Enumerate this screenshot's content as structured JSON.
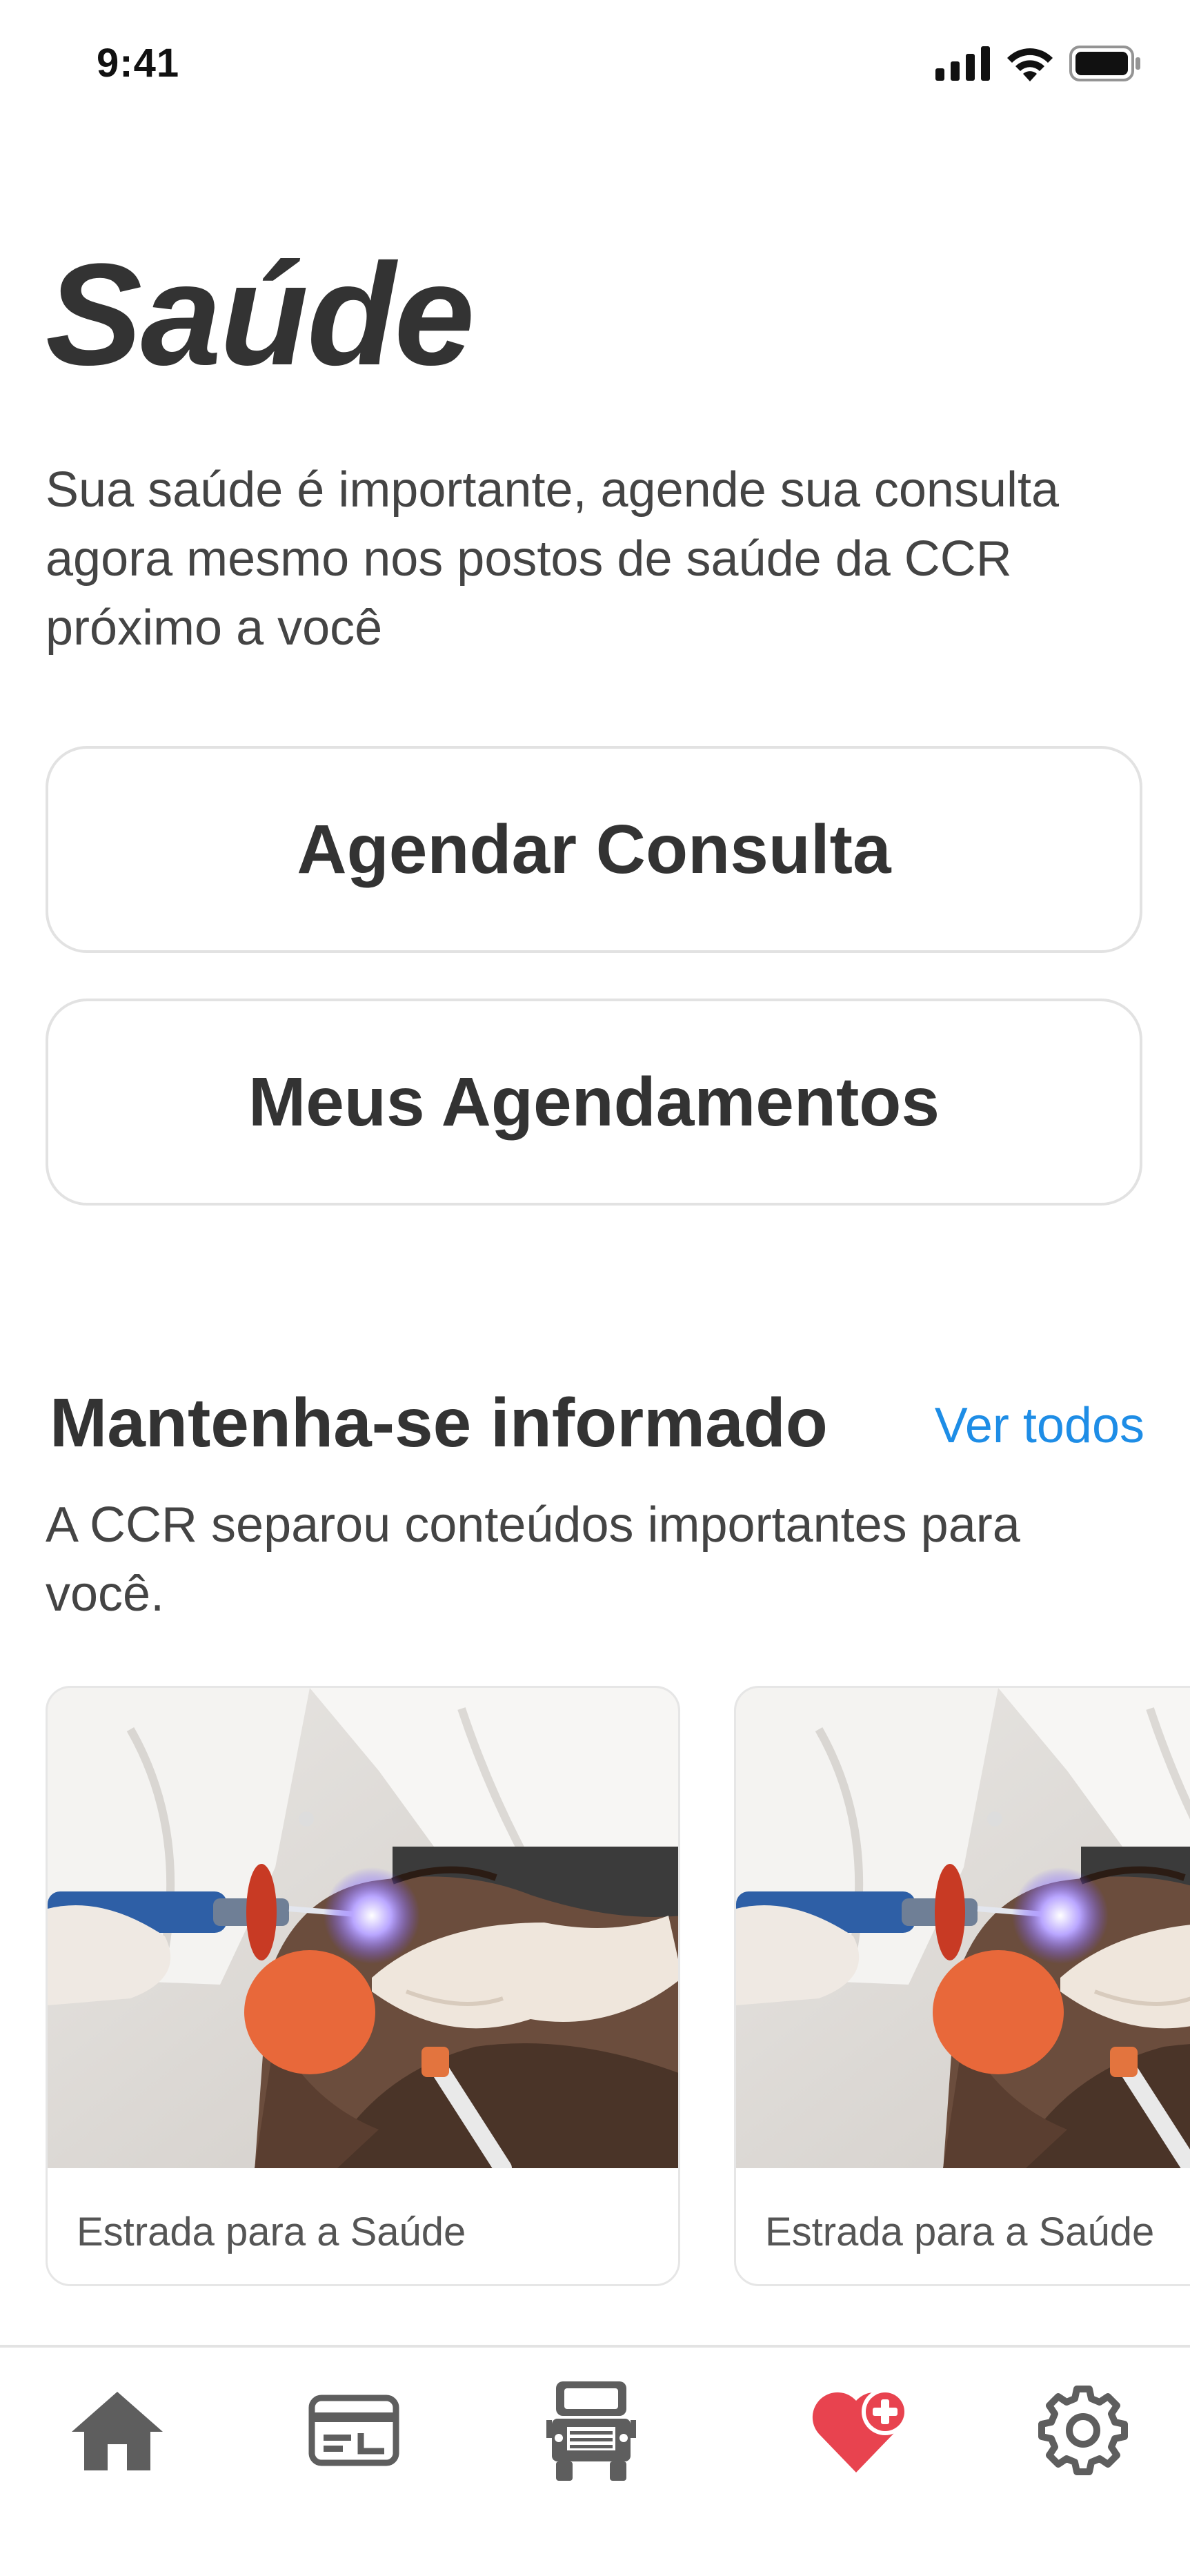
{
  "status_bar": {
    "time": "9:41",
    "icons": [
      "signal-icon",
      "wifi-icon",
      "battery-icon"
    ]
  },
  "header": {
    "title": "Saúde",
    "subtitle": "Sua saúde é importante, agende sua consulta agora mesmo nos postos de saúde da CCR próximo a você"
  },
  "actions": {
    "agendar_label": "Agendar Consulta",
    "meus_label": "Meus Agendamentos"
  },
  "news": {
    "title": "Mantenha-se informado",
    "see_all": "Ver todos",
    "description": "A CCR separou conteúdos importantes para você.",
    "cards": [
      {
        "caption": "Estrada para a Saúde"
      },
      {
        "caption": "Estrada para a Saúde"
      }
    ]
  },
  "tabbar": {
    "items": [
      {
        "icon": "home-icon",
        "active": false
      },
      {
        "icon": "card-icon",
        "active": false
      },
      {
        "icon": "truck-icon",
        "active": false
      },
      {
        "icon": "health-heart-icon",
        "active": true
      },
      {
        "icon": "gear-icon",
        "active": false
      }
    ]
  },
  "colors": {
    "accent": "#1e8de6",
    "active_tab": "#e8434f",
    "inactive_tab": "#5e5e5e",
    "text": "#333333"
  }
}
